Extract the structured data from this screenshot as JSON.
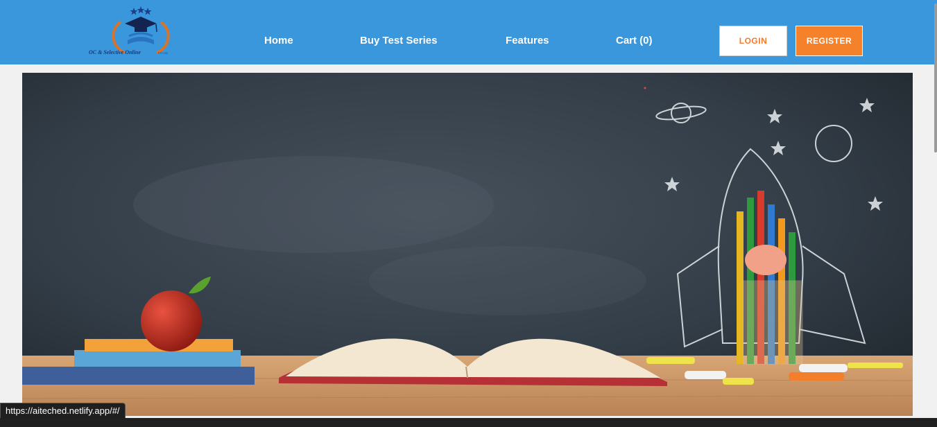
{
  "brand": {
    "logo_text": "OC & Selective Online",
    "logo_suffix": "PTY LTD"
  },
  "nav": {
    "home": "Home",
    "buy_test_series": "Buy Test Series",
    "features": "Features",
    "cart": "Cart (0)"
  },
  "auth": {
    "login": "LOGIN",
    "register": "REGISTER"
  },
  "status_bar": {
    "url": "https://aiteched.netlify.app/#/"
  },
  "colors": {
    "navbar": "#3a97dc",
    "accent": "#f5822a",
    "chalkboard": "#2f3a44"
  }
}
